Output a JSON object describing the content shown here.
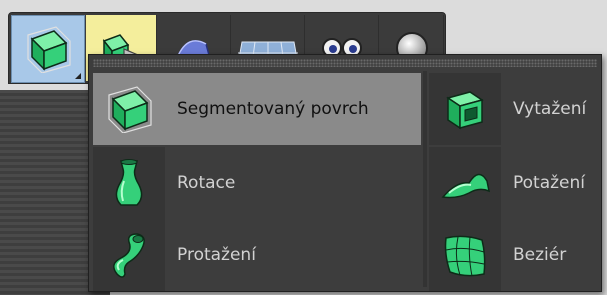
{
  "toolbar": {
    "buttons": [
      {
        "icon": "subdivision-surface-icon",
        "active": true
      },
      {
        "icon": "generator-cube-icon"
      },
      {
        "icon": "bend-deformer-icon"
      },
      {
        "icon": "grid-floor-icon"
      },
      {
        "icon": "eyes-camera-icon"
      },
      {
        "icon": "light-sphere-icon"
      }
    ]
  },
  "menu": {
    "items": [
      {
        "label": "Segmentovaný povrch",
        "icon": "subdivision-surface-icon",
        "selected": true
      },
      {
        "label": "Rotace",
        "icon": "lathe-vase-icon"
      },
      {
        "label": "Protažení",
        "icon": "sweep-tube-icon"
      },
      {
        "label": "Vytažení",
        "icon": "extrude-box-icon"
      },
      {
        "label": "Potažení",
        "icon": "loft-surface-icon"
      },
      {
        "label": "Beziér",
        "icon": "bezier-patch-icon"
      }
    ]
  },
  "colors": {
    "accent_green": "#35d07a",
    "active_tool_bg": "#a8c8e8",
    "highlight_bg": "#f4ee9c",
    "menu_bg": "#3d3d3d",
    "selected_item_bg": "#8a8a8a"
  }
}
